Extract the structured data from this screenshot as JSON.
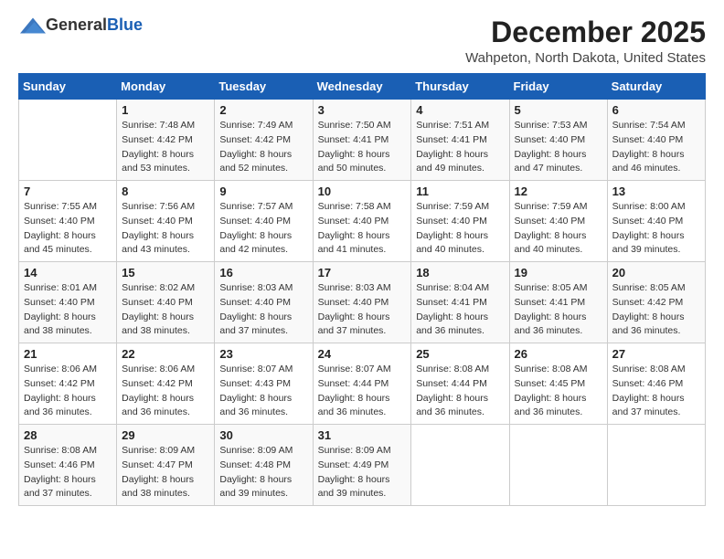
{
  "header": {
    "logo_general": "General",
    "logo_blue": "Blue",
    "month_title": "December 2025",
    "location": "Wahpeton, North Dakota, United States"
  },
  "days_of_week": [
    "Sunday",
    "Monday",
    "Tuesday",
    "Wednesday",
    "Thursday",
    "Friday",
    "Saturday"
  ],
  "weeks": [
    [
      {
        "day": "",
        "sunrise": "",
        "sunset": "",
        "daylight": ""
      },
      {
        "day": "1",
        "sunrise": "Sunrise: 7:48 AM",
        "sunset": "Sunset: 4:42 PM",
        "daylight": "Daylight: 8 hours and 53 minutes."
      },
      {
        "day": "2",
        "sunrise": "Sunrise: 7:49 AM",
        "sunset": "Sunset: 4:42 PM",
        "daylight": "Daylight: 8 hours and 52 minutes."
      },
      {
        "day": "3",
        "sunrise": "Sunrise: 7:50 AM",
        "sunset": "Sunset: 4:41 PM",
        "daylight": "Daylight: 8 hours and 50 minutes."
      },
      {
        "day": "4",
        "sunrise": "Sunrise: 7:51 AM",
        "sunset": "Sunset: 4:41 PM",
        "daylight": "Daylight: 8 hours and 49 minutes."
      },
      {
        "day": "5",
        "sunrise": "Sunrise: 7:53 AM",
        "sunset": "Sunset: 4:40 PM",
        "daylight": "Daylight: 8 hours and 47 minutes."
      },
      {
        "day": "6",
        "sunrise": "Sunrise: 7:54 AM",
        "sunset": "Sunset: 4:40 PM",
        "daylight": "Daylight: 8 hours and 46 minutes."
      }
    ],
    [
      {
        "day": "7",
        "sunrise": "Sunrise: 7:55 AM",
        "sunset": "Sunset: 4:40 PM",
        "daylight": "Daylight: 8 hours and 45 minutes."
      },
      {
        "day": "8",
        "sunrise": "Sunrise: 7:56 AM",
        "sunset": "Sunset: 4:40 PM",
        "daylight": "Daylight: 8 hours and 43 minutes."
      },
      {
        "day": "9",
        "sunrise": "Sunrise: 7:57 AM",
        "sunset": "Sunset: 4:40 PM",
        "daylight": "Daylight: 8 hours and 42 minutes."
      },
      {
        "day": "10",
        "sunrise": "Sunrise: 7:58 AM",
        "sunset": "Sunset: 4:40 PM",
        "daylight": "Daylight: 8 hours and 41 minutes."
      },
      {
        "day": "11",
        "sunrise": "Sunrise: 7:59 AM",
        "sunset": "Sunset: 4:40 PM",
        "daylight": "Daylight: 8 hours and 40 minutes."
      },
      {
        "day": "12",
        "sunrise": "Sunrise: 7:59 AM",
        "sunset": "Sunset: 4:40 PM",
        "daylight": "Daylight: 8 hours and 40 minutes."
      },
      {
        "day": "13",
        "sunrise": "Sunrise: 8:00 AM",
        "sunset": "Sunset: 4:40 PM",
        "daylight": "Daylight: 8 hours and 39 minutes."
      }
    ],
    [
      {
        "day": "14",
        "sunrise": "Sunrise: 8:01 AM",
        "sunset": "Sunset: 4:40 PM",
        "daylight": "Daylight: 8 hours and 38 minutes."
      },
      {
        "day": "15",
        "sunrise": "Sunrise: 8:02 AM",
        "sunset": "Sunset: 4:40 PM",
        "daylight": "Daylight: 8 hours and 38 minutes."
      },
      {
        "day": "16",
        "sunrise": "Sunrise: 8:03 AM",
        "sunset": "Sunset: 4:40 PM",
        "daylight": "Daylight: 8 hours and 37 minutes."
      },
      {
        "day": "17",
        "sunrise": "Sunrise: 8:03 AM",
        "sunset": "Sunset: 4:40 PM",
        "daylight": "Daylight: 8 hours and 37 minutes."
      },
      {
        "day": "18",
        "sunrise": "Sunrise: 8:04 AM",
        "sunset": "Sunset: 4:41 PM",
        "daylight": "Daylight: 8 hours and 36 minutes."
      },
      {
        "day": "19",
        "sunrise": "Sunrise: 8:05 AM",
        "sunset": "Sunset: 4:41 PM",
        "daylight": "Daylight: 8 hours and 36 minutes."
      },
      {
        "day": "20",
        "sunrise": "Sunrise: 8:05 AM",
        "sunset": "Sunset: 4:42 PM",
        "daylight": "Daylight: 8 hours and 36 minutes."
      }
    ],
    [
      {
        "day": "21",
        "sunrise": "Sunrise: 8:06 AM",
        "sunset": "Sunset: 4:42 PM",
        "daylight": "Daylight: 8 hours and 36 minutes."
      },
      {
        "day": "22",
        "sunrise": "Sunrise: 8:06 AM",
        "sunset": "Sunset: 4:42 PM",
        "daylight": "Daylight: 8 hours and 36 minutes."
      },
      {
        "day": "23",
        "sunrise": "Sunrise: 8:07 AM",
        "sunset": "Sunset: 4:43 PM",
        "daylight": "Daylight: 8 hours and 36 minutes."
      },
      {
        "day": "24",
        "sunrise": "Sunrise: 8:07 AM",
        "sunset": "Sunset: 4:44 PM",
        "daylight": "Daylight: 8 hours and 36 minutes."
      },
      {
        "day": "25",
        "sunrise": "Sunrise: 8:08 AM",
        "sunset": "Sunset: 4:44 PM",
        "daylight": "Daylight: 8 hours and 36 minutes."
      },
      {
        "day": "26",
        "sunrise": "Sunrise: 8:08 AM",
        "sunset": "Sunset: 4:45 PM",
        "daylight": "Daylight: 8 hours and 36 minutes."
      },
      {
        "day": "27",
        "sunrise": "Sunrise: 8:08 AM",
        "sunset": "Sunset: 4:46 PM",
        "daylight": "Daylight: 8 hours and 37 minutes."
      }
    ],
    [
      {
        "day": "28",
        "sunrise": "Sunrise: 8:08 AM",
        "sunset": "Sunset: 4:46 PM",
        "daylight": "Daylight: 8 hours and 37 minutes."
      },
      {
        "day": "29",
        "sunrise": "Sunrise: 8:09 AM",
        "sunset": "Sunset: 4:47 PM",
        "daylight": "Daylight: 8 hours and 38 minutes."
      },
      {
        "day": "30",
        "sunrise": "Sunrise: 8:09 AM",
        "sunset": "Sunset: 4:48 PM",
        "daylight": "Daylight: 8 hours and 39 minutes."
      },
      {
        "day": "31",
        "sunrise": "Sunrise: 8:09 AM",
        "sunset": "Sunset: 4:49 PM",
        "daylight": "Daylight: 8 hours and 39 minutes."
      },
      {
        "day": "",
        "sunrise": "",
        "sunset": "",
        "daylight": ""
      },
      {
        "day": "",
        "sunrise": "",
        "sunset": "",
        "daylight": ""
      },
      {
        "day": "",
        "sunrise": "",
        "sunset": "",
        "daylight": ""
      }
    ]
  ]
}
